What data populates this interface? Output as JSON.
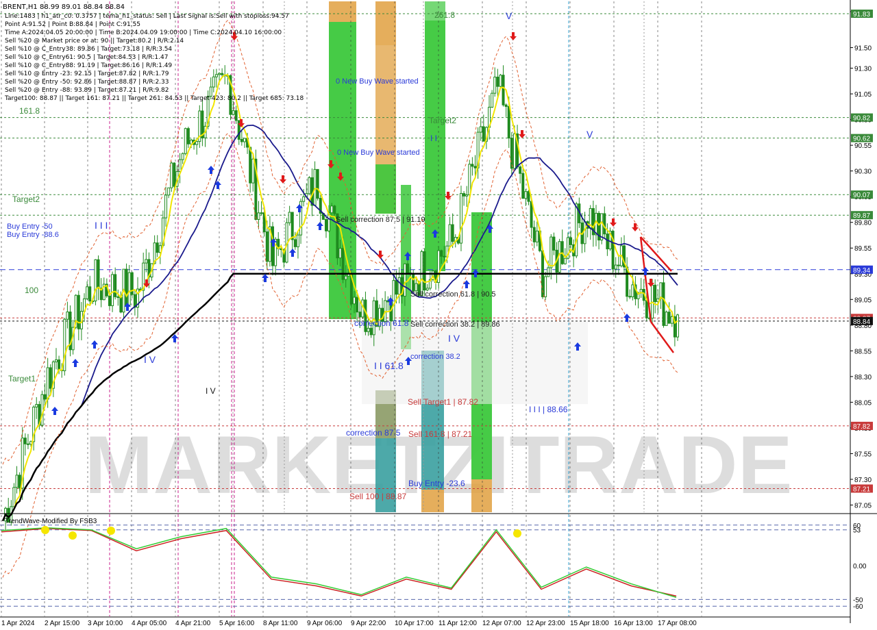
{
  "header": {
    "symbol_line": "BRENT,H1  88.99 89.01 88.84 88.84",
    "info_lines": [
      "Line:1483 | h1_atr_c0: 0.3757 | tema_h1_status: Sell | Last Signal is:Sell with stoploss:94.57",
      "Point A:91.52 | Point B:88.84 | Point C:91.55",
      "Time A:2024.04.05 20:00:00 | Time B:2024.04.09 19:00:00 | Time C:2024.04.10 16:00:00",
      "Sell %20 @ Market price or at: 90 || Target:80.2 | R/R:2.14",
      "Sell %10 @ C_Entry38: 89.86 | Target:73.18 | R/R:3.54",
      "Sell %10 @ C_Entry61: 90.5 | Target:84.53 | R/R:1.47",
      "Sell %10 @ C_Entry88: 91.19 | Target:86.16 | R/R:1.49",
      "Sell %10 @ Entry -23: 92.15 | Target:87.82 | R/R:1.79",
      "Sell %20 @ Entry -50: 92.86 | Target:88.87 | R/R:2.33",
      "Sell %20 @ Entry -88: 93.89 | Target:87.21 | R/R:9.82",
      "Target100: 88.87 || Target 161: 87.21 || Target 261: 84.53 || Target 423: 80.2 || Target 685: 73.18"
    ]
  },
  "watermark": "MARKETZITRADE",
  "price_axis": {
    "ticks": [
      "91.85",
      "91.50",
      "91.30",
      "91.05",
      "90.80",
      "90.55",
      "90.30",
      "90.05",
      "89.80",
      "89.55",
      "89.30",
      "89.05",
      "88.80",
      "88.55",
      "88.30",
      "88.05",
      "87.80",
      "87.55",
      "87.30",
      "87.05"
    ],
    "tick_values": [
      91.85,
      91.5,
      91.3,
      91.05,
      90.8,
      90.55,
      90.3,
      90.05,
      89.8,
      89.55,
      89.3,
      89.05,
      88.8,
      88.55,
      88.3,
      88.05,
      87.8,
      87.55,
      87.3,
      87.05
    ],
    "markers": [
      {
        "label": "91.83",
        "value": 91.83,
        "color": "#3a8a3a"
      },
      {
        "label": "90.82",
        "value": 90.82,
        "color": "#3a8a3a"
      },
      {
        "label": "90.62",
        "value": 90.62,
        "color": "#3a8a3a"
      },
      {
        "label": "90.07",
        "value": 90.07,
        "color": "#3a8a3a"
      },
      {
        "label": "89.87",
        "value": 89.87,
        "color": "#3a8a3a"
      },
      {
        "label": "89.34",
        "value": 89.34,
        "color": "#2a3ad8"
      },
      {
        "label": "88.87",
        "value": 88.87,
        "color": "#c83a3a"
      },
      {
        "label": "88.84",
        "value": 88.84,
        "color": "#111111"
      },
      {
        "label": "87.82",
        "value": 87.82,
        "color": "#c83a3a"
      },
      {
        "label": "87.21",
        "value": 87.21,
        "color": "#c83a3a"
      }
    ]
  },
  "time_axis": [
    "1 Apr 2024",
    "2 Apr 15:00",
    "3 Apr 10:00",
    "4 Apr 05:00",
    "4 Apr 21:00",
    "5 Apr 16:00",
    "8 Apr 11:00",
    "9 Apr 06:00",
    "9 Apr 22:00",
    "10 Apr 17:00",
    "11 Apr 12:00",
    "12 Apr 07:00",
    "12 Apr 23:00",
    "15 Apr 18:00",
    "16 Apr 13:00",
    "17 Apr 08:00"
  ],
  "chart_labels": [
    {
      "text": "161.8",
      "color": "#3a8a3a",
      "kind": "fib"
    },
    {
      "text": "Target2",
      "color": "#3a8a3a",
      "kind": "fib"
    },
    {
      "text": "100",
      "color": "#3a8a3a",
      "kind": "fib"
    },
    {
      "text": "Target1",
      "color": "#3a8a3a",
      "kind": "fib"
    },
    {
      "text": "261.8",
      "color": "#3a8a3a",
      "kind": "fib"
    },
    {
      "text": "Target2",
      "color": "#3a8a3a",
      "kind": "fib"
    },
    {
      "text": "I I I",
      "color": "#2a3ad8",
      "kind": "wave"
    },
    {
      "text": "I V",
      "color": "#2a3ad8",
      "kind": "wave"
    },
    {
      "text": "V",
      "color": "#2a3ad8",
      "kind": "wave"
    },
    {
      "text": "I I",
      "color": "#2a3ad8",
      "kind": "wave"
    },
    {
      "text": "I V",
      "color": "#2a3ad8",
      "kind": "wave"
    },
    {
      "text": "V",
      "color": "#2a3ad8",
      "kind": "wave"
    },
    {
      "text": "I I 61.8",
      "color": "#2a3ad8",
      "kind": "wave"
    },
    {
      "text": "I V",
      "color": "#111111",
      "kind": "wave"
    },
    {
      "text": "I I I | 88.66",
      "color": "#2a3ad8",
      "kind": "wave"
    },
    {
      "text": "0 New Buy Wave started",
      "color": "#2a3ad8",
      "kind": "note"
    },
    {
      "text": "0 New Buy Wave started",
      "color": "#2a3ad8",
      "kind": "note"
    },
    {
      "text": "Sell correction 87.5 | 91.19",
      "color": "#222222",
      "kind": "note"
    },
    {
      "text": "Sell correction 61.8 | 90.5",
      "color": "#222222",
      "kind": "note"
    },
    {
      "text": "Sell correction 38.2 | 89.86",
      "color": "#222222",
      "kind": "note"
    },
    {
      "text": "correction 38.2",
      "color": "#2a3ad8",
      "kind": "note"
    },
    {
      "text": "correction 61.8",
      "color": "#2a3ad8",
      "kind": "note"
    },
    {
      "text": "correction 87.5",
      "color": "#2a3ad8",
      "kind": "note"
    },
    {
      "text": "Sell 100 | 88.87",
      "color": "#c83a3a",
      "kind": "note"
    },
    {
      "text": "Sell Target1 | 87.82",
      "color": "#c83a3a",
      "kind": "note"
    },
    {
      "text": "Sell 161.8 | 87.21",
      "color": "#c83a3a",
      "kind": "note"
    },
    {
      "text": "Buy Entry -23.6",
      "color": "#2a3ad8",
      "kind": "note"
    },
    {
      "text": "Buy Entry -50",
      "color": "#2a3ad8",
      "kind": "note"
    },
    {
      "text": "Buy Entry -88.6",
      "color": "#2a3ad8",
      "kind": "note"
    }
  ],
  "oscillator": {
    "title": "TrendWave-Modified By FSB3",
    "ticks": [
      "60",
      "53",
      "0.00",
      "-50",
      "-60"
    ],
    "tick_values": [
      60,
      53,
      0,
      -50,
      -60
    ],
    "range": [
      -75,
      75
    ]
  },
  "colors": {
    "background": "#ffffff",
    "bull_candle": "#1f8a1f",
    "bear_candle": "#1f8a1f",
    "ma_blue": "#1a1a8c",
    "ma_black": "#000000",
    "ma_yellow": "#f2e600",
    "green_zone": "#3cc83c",
    "orange_zone": "#e0a040",
    "teal_zone": "#3aa0a0",
    "buy_arrow": "#1a3ae0",
    "sell_arrow": "#e01a1a",
    "osc_green": "#33cc33",
    "osc_red": "#cc2222"
  },
  "chart_data": {
    "type": "line",
    "title": "BRENT,H1",
    "x": [
      "1 Apr 2024",
      "2 Apr 15:00",
      "3 Apr 10:00",
      "4 Apr 05:00",
      "4 Apr 21:00",
      "5 Apr 16:00",
      "8 Apr 11:00",
      "9 Apr 06:00",
      "9 Apr 22:00",
      "10 Apr 17:00",
      "11 Apr 12:00",
      "12 Apr 07:00",
      "12 Apr 23:00",
      "15 Apr 18:00",
      "16 Apr 13:00",
      "17 Apr 08:00"
    ],
    "ylim": [
      86.98,
      91.95
    ],
    "series": [
      {
        "values": [
          86.9,
          88.3,
          89.2,
          89.1,
          90.5,
          91.2,
          89.4,
          90.2,
          88.9,
          89.2,
          89.6,
          91.1,
          89.3,
          89.9,
          89.2,
          88.9
        ]
      }
    ],
    "oscillator_series": [
      {
        "values": [
          50,
          55,
          52,
          22,
          40,
          52,
          -20,
          -30,
          -45,
          -20,
          -35,
          50,
          -35,
          -5,
          -30,
          -45
        ]
      },
      {
        "values": [
          52,
          56,
          53,
          25,
          43,
          55,
          -17,
          -27,
          -43,
          -17,
          -33,
          53,
          -32,
          -2,
          -27,
          -47
        ]
      }
    ]
  }
}
